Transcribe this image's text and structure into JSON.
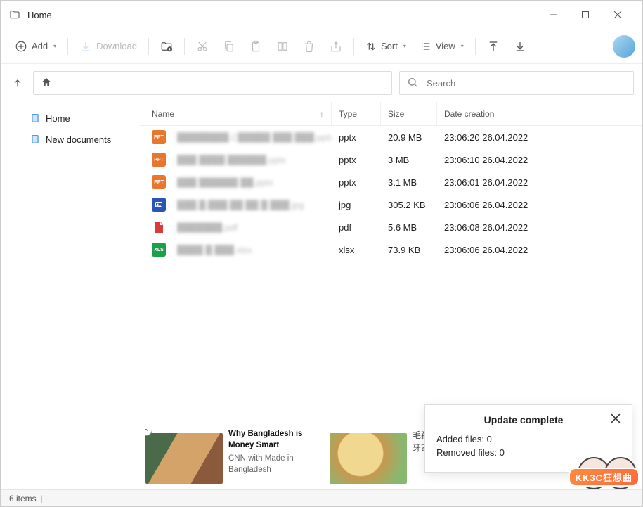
{
  "window": {
    "title": "Home"
  },
  "toolbar": {
    "add_label": "Add",
    "download_label": "Download",
    "sort_label": "Sort",
    "view_label": "View"
  },
  "search": {
    "placeholder": "Search"
  },
  "sidebar": {
    "items": [
      {
        "label": "Home"
      },
      {
        "label": "New documents"
      }
    ]
  },
  "columns": {
    "name": "Name",
    "type": "Type",
    "size": "Size",
    "date": "Date creation"
  },
  "files": [
    {
      "name": "████████.C█████ ███ ███.pptx",
      "type": "pptx",
      "size": "20.9 MB",
      "date": "23:06:20 26.04.2022",
      "icon": "ppt"
    },
    {
      "name": "███ ████ ██████.pptx",
      "type": "pptx",
      "size": "3 MB",
      "date": "23:06:10 26.04.2022",
      "icon": "ppt"
    },
    {
      "name": "███ ██████ ██.pptx",
      "type": "pptx",
      "size": "3.1 MB",
      "date": "23:06:01 26.04.2022",
      "icon": "ppt"
    },
    {
      "name": "███.█.███.██ ██ █ ███.jpg",
      "type": "jpg",
      "size": "305.2 KB",
      "date": "23:06:06 26.04.2022",
      "icon": "jpg"
    },
    {
      "name": "███████.pdf",
      "type": "pdf",
      "size": "5.6 MB",
      "date": "23:06:08 26.04.2022",
      "icon": "pdf"
    },
    {
      "name": "████ █ ███.xlsx",
      "type": "xlsx",
      "size": "73.9 KB",
      "date": "23:06:06 26.04.2022",
      "icon": "xls"
    }
  ],
  "toast": {
    "title": "Update complete",
    "added_label": "Added files:",
    "added_value": "0",
    "removed_label": "Removed files:",
    "removed_value": "0"
  },
  "ads": [
    {
      "headline": "Why Bangladesh is Money Smart",
      "source": "CNN with Made in Bangladesh"
    },
    {
      "headline": "毛孩",
      "source": "牙？"
    }
  ],
  "watermark": "KK3C狂想曲",
  "statusbar": {
    "item_count": "6 items"
  }
}
